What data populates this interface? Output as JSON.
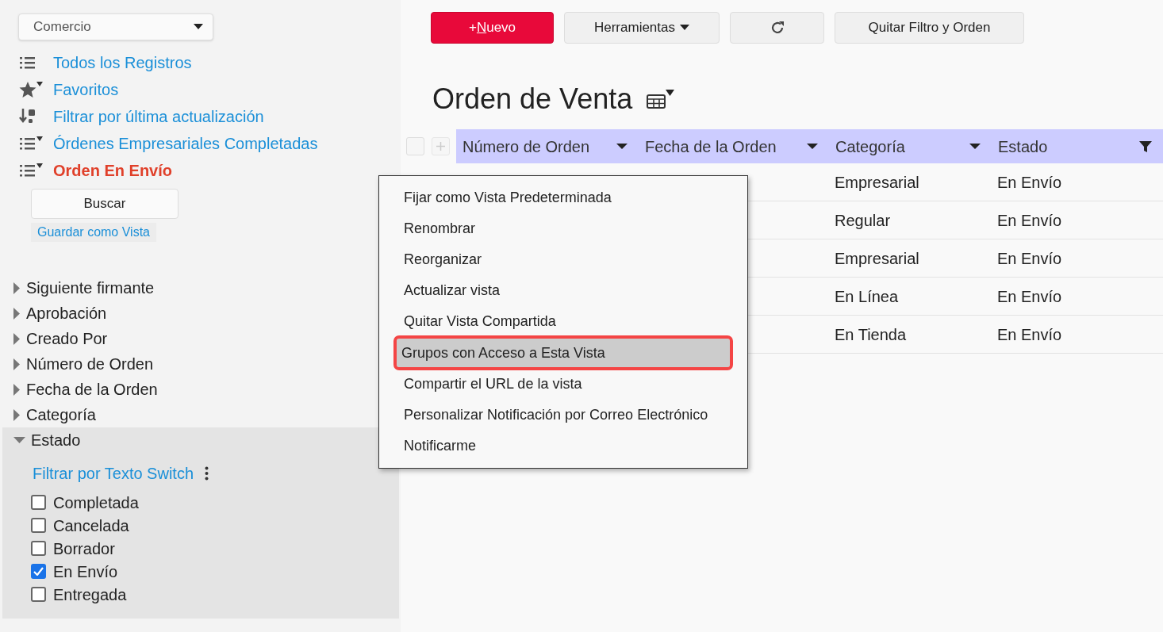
{
  "sidebar": {
    "app_selector": {
      "value": "Comercio"
    },
    "views": [
      {
        "kind": "list",
        "label": "Todos los Registros",
        "selected": false
      },
      {
        "kind": "star",
        "label": "Favoritos",
        "selected": false
      },
      {
        "kind": "sort",
        "label": "Filtrar por última actualización",
        "selected": false
      },
      {
        "kind": "list-filter",
        "label": "Órdenes Empresariales Completadas",
        "selected": false
      },
      {
        "kind": "list-filter",
        "label": "Orden En Envío",
        "selected": true
      }
    ],
    "search_button": "Buscar",
    "save_view_link": "Guardar como Vista",
    "fields": [
      {
        "label": "Siguiente firmante",
        "expanded": false
      },
      {
        "label": "Aprobación",
        "expanded": false
      },
      {
        "label": "Creado Por",
        "expanded": false
      },
      {
        "label": "Número de Orden",
        "expanded": false
      },
      {
        "label": "Fecha de la Orden",
        "expanded": false
      },
      {
        "label": "Categoría",
        "expanded": false
      },
      {
        "label": "Estado",
        "expanded": true,
        "filter_mode": "Filtrar por Texto Switch",
        "options": [
          {
            "label": "Completada",
            "checked": false
          },
          {
            "label": "Cancelada",
            "checked": false
          },
          {
            "label": "Borrador",
            "checked": false
          },
          {
            "label": "En Envío",
            "checked": true
          },
          {
            "label": "Entregada",
            "checked": false
          }
        ]
      }
    ]
  },
  "toolbar": {
    "new_button": {
      "prefix": "+",
      "label": "Nuevo",
      "first_letter_underlined": true
    },
    "tools_button": "Herramientas",
    "clear_button": "Quitar Filtro y Orden"
  },
  "title": "Orden de Venta",
  "table": {
    "select_all": {
      "checked": false
    },
    "columns": [
      {
        "label": "Número de Orden",
        "filtered": false
      },
      {
        "label": "Fecha de la Orden",
        "filtered": false
      },
      {
        "label": "Categoría",
        "filtered": false
      },
      {
        "label": "Estado",
        "filtered": true
      }
    ],
    "rows": [
      [
        "Empresarial",
        "En Envío"
      ],
      [
        "Regular",
        "En Envío"
      ],
      [
        "Empresarial",
        "En Envío"
      ],
      [
        "En Línea",
        "En Envío"
      ],
      [
        "En Tienda",
        "En Envío"
      ]
    ]
  },
  "context_menu": [
    {
      "label": "Fijar como Vista Predeterminada",
      "selected": false
    },
    {
      "label": "Renombrar",
      "selected": false
    },
    {
      "label": "Reorganizar",
      "selected": false
    },
    {
      "label": "Actualizar vista",
      "selected": false
    },
    {
      "label": "Quitar Vista Compartida",
      "selected": false
    },
    {
      "label": "Grupos con Acceso a Esta Vista",
      "selected": true
    },
    {
      "label": "Compartir el URL de la vista",
      "selected": false
    },
    {
      "label": "Personalizar Notificación por Correo Electrónico",
      "selected": false
    },
    {
      "label": "Notificarme",
      "selected": false
    }
  ]
}
